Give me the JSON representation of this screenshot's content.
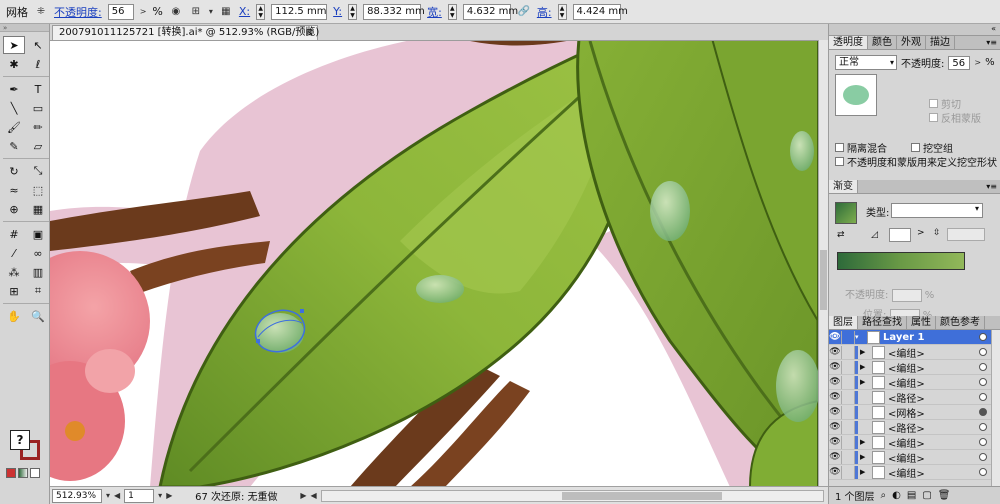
{
  "control_bar": {
    "object_type": "网格",
    "opacity_label": "不透明度:",
    "opacity_value": "56",
    "percent": "%",
    "x_label": "X:",
    "x_value": "112.5 mm",
    "y_label": "Y:",
    "y_value": "88.332 mm",
    "w_label": "宽:",
    "w_value": "4.632 mm",
    "h_label": "高:",
    "h_value": "4.424 mm"
  },
  "document": {
    "tab_title": "200791011125721 [转换].ai* @ 512.93% (RGB/预览)",
    "close": "⊠"
  },
  "status_bar": {
    "zoom": "512.93%",
    "artboard": "1",
    "info": "67 次还原: 无重做"
  },
  "tools": [
    {
      "name": "selection-tool",
      "glyph": "➤",
      "selected": true
    },
    {
      "name": "direct-selection-tool",
      "glyph": "↖"
    },
    {
      "name": "magic-wand-tool",
      "glyph": "✱"
    },
    {
      "name": "lasso-tool",
      "glyph": "ℓ"
    },
    {
      "name": "pen-tool",
      "glyph": "✒"
    },
    {
      "name": "type-tool",
      "glyph": "T"
    },
    {
      "name": "line-tool",
      "glyph": "╲"
    },
    {
      "name": "rectangle-tool",
      "glyph": "▭"
    },
    {
      "name": "paintbrush-tool",
      "glyph": "🖌"
    },
    {
      "name": "pencil-tool",
      "glyph": "✏"
    },
    {
      "name": "blob-brush-tool",
      "glyph": "✎"
    },
    {
      "name": "eraser-tool",
      "glyph": "▱"
    },
    {
      "name": "rotate-tool",
      "glyph": "↻"
    },
    {
      "name": "scale-tool",
      "glyph": "⤡"
    },
    {
      "name": "warp-tool",
      "glyph": "≈"
    },
    {
      "name": "free-transform-tool",
      "glyph": "⬚"
    },
    {
      "name": "shape-builder-tool",
      "glyph": "⊕"
    },
    {
      "name": "perspective-grid-tool",
      "glyph": "▦"
    },
    {
      "name": "mesh-tool",
      "glyph": "#"
    },
    {
      "name": "gradient-tool",
      "glyph": "▣"
    },
    {
      "name": "eyedropper-tool",
      "glyph": "⁄"
    },
    {
      "name": "blend-tool",
      "glyph": "∞"
    },
    {
      "name": "symbol-sprayer-tool",
      "glyph": "⁂"
    },
    {
      "name": "column-graph-tool",
      "glyph": "▥"
    },
    {
      "name": "artboard-tool",
      "glyph": "⊞"
    },
    {
      "name": "slice-tool",
      "glyph": "⌗"
    },
    {
      "name": "hand-tool",
      "glyph": "✋"
    },
    {
      "name": "zoom-tool",
      "glyph": "🔍"
    }
  ],
  "transparency_panel": {
    "tabs": [
      "透明度",
      "颜色",
      "外观",
      "描边"
    ],
    "blend_mode": "正常",
    "opacity_label": "不透明度:",
    "opacity_value": "56",
    "percent": "%",
    "clip": "剪切",
    "invert_mask": "反相蒙版",
    "isolate_blending": "隔离混合",
    "knockout_group": "挖空组",
    "opacity_mask_defines_knockout": "不透明度和蒙版用来定义挖空形状"
  },
  "gradient_panel": {
    "title": "渐变",
    "type_label": "类型:",
    "opacity_label": "不透明度:",
    "location_label": "位置:",
    "percent": "%"
  },
  "layers_panel": {
    "tabs": [
      "图层",
      "路径查找",
      "属性",
      "颜色参考"
    ],
    "layer_name": "Layer 1",
    "items": [
      "<编组>",
      "<编组>",
      "<编组>",
      "<路径>",
      "<网格>",
      "<路径>",
      "<编组>",
      "<编组>",
      "<编组>"
    ],
    "footer": "1 个图层"
  },
  "colors": {
    "leaf_dark": "#5d8a22",
    "leaf_light": "#97bd3f",
    "branch": "#6b3a1c",
    "shadow_pink": "#e6c2d3",
    "flower": "#e67b86",
    "selection_blue": "#3d6fe0"
  }
}
